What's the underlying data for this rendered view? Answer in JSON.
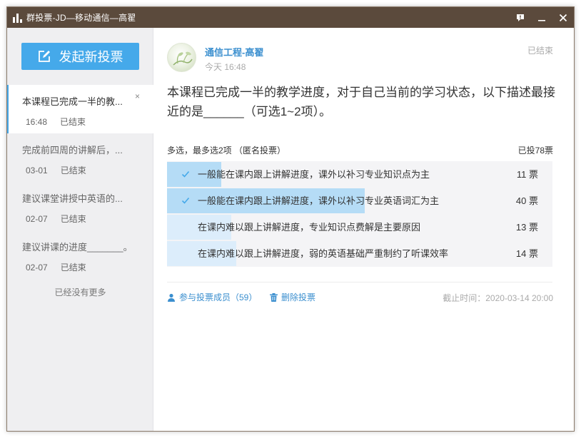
{
  "window": {
    "title": "群投票-JD—移动通信—高翟"
  },
  "sidebar": {
    "new_vote_label": "发起新投票",
    "items": [
      {
        "title": "本课程已完成一半的教...",
        "time": "16:48",
        "status": "已结束",
        "active": true
      },
      {
        "title": "完成前四周的讲解后，...",
        "time": "03-01",
        "status": "已结束",
        "active": false
      },
      {
        "title": "建议课堂讲授中英语的...",
        "time": "02-07",
        "status": "已结束",
        "active": false
      },
      {
        "title": "建议讲课的进度_______。",
        "time": "02-07",
        "status": "已结束",
        "active": false
      }
    ],
    "no_more_text": "已经没有更多"
  },
  "post": {
    "author": "通信工程-高翟",
    "time": "今天 16:48",
    "status": "已结束",
    "question": "本课程已完成一半的教学进度，对于自己当前的学习状态，以下描述最接近的是______（可选1~2项）。",
    "vote_info": "多选，最多选2项 （匿名投票）",
    "voted_total": "已投78票",
    "options": [
      {
        "label": "一般能在课内跟上讲解进度，课外以补习专业知识点为主",
        "count": "11 票",
        "votes": 11,
        "checked": true
      },
      {
        "label": "一般能在课内跟上讲解进度，课外以补习专业英语词汇为主",
        "count": "40 票",
        "votes": 40,
        "checked": true
      },
      {
        "label": "在课内难以跟上讲解进度，专业知识点费解是主要原因",
        "count": "13 票",
        "votes": 13,
        "checked": false
      },
      {
        "label": "在课内难以跟上讲解进度，弱的英语基础严重制约了听课效率",
        "count": "14 票",
        "votes": 14,
        "checked": false
      }
    ],
    "total_votes": 78,
    "members_label": "参与投票成员（59）",
    "delete_label": "删除投票",
    "deadline": "截止时间：2020-03-14 20:00"
  },
  "colors": {
    "titlebar": "#5b4a3c",
    "accent": "#45a9ea",
    "link": "#3b8fcf",
    "checked_fill": "#b5dcf6",
    "unchecked_fill": "#dcedfb"
  },
  "icons": [
    "bar-chart-icon",
    "feedback-icon",
    "minimize-icon",
    "close-icon",
    "edit-icon",
    "check-icon",
    "person-icon",
    "trash-icon"
  ]
}
